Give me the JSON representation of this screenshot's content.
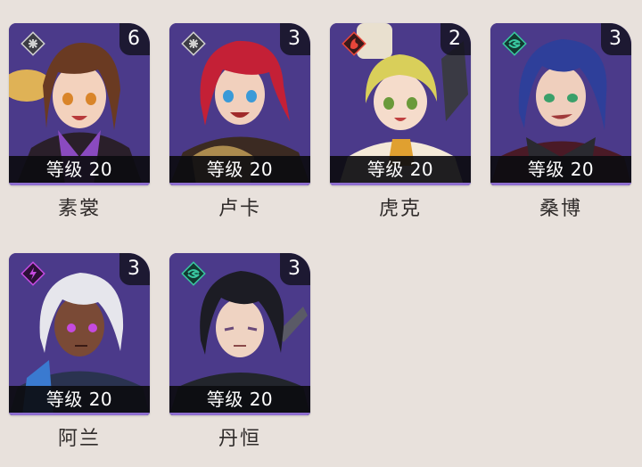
{
  "characters": [
    {
      "name": "素裳",
      "level_label": "等级 20",
      "eidolon": "6",
      "path_icon": "hunt-path-icon",
      "element_icon": "physical-element-icon",
      "element_color": "#c8c8c8",
      "hair": "#6a3a22",
      "skin": "#f3d2bd",
      "outfit": "#f0c050"
    },
    {
      "name": "卢卡",
      "level_label": "等级 20",
      "eidolon": "3",
      "path_icon": "nihility-path-icon",
      "element_icon": "physical-element-icon",
      "element_color": "#c8c8c8",
      "hair": "#c42036",
      "skin": "#f1d0bd",
      "outfit": "#3b2a22"
    },
    {
      "name": "虎克",
      "level_label": "等级 20",
      "eidolon": "2",
      "path_icon": "destruction-path-icon",
      "element_icon": "fire-element-icon",
      "element_color": "#e8463a",
      "hair": "#d9cf5a",
      "skin": "#f5dccb",
      "outfit": "#f4e9d8"
    },
    {
      "name": "桑博",
      "level_label": "等级 20",
      "eidolon": "3",
      "path_icon": "nihility-path-icon",
      "element_icon": "wind-element-icon",
      "element_color": "#39c7a0",
      "hair": "#2e3f9a",
      "skin": "#efcfbd",
      "outfit": "#4a1a26"
    },
    {
      "name": "阿兰",
      "level_label": "等级 20",
      "eidolon": "3",
      "path_icon": "destruction-path-icon",
      "element_icon": "lightning-element-icon",
      "element_color": "#c54ae0",
      "hair": "#e6e6ec",
      "skin": "#7a4a36",
      "outfit": "#2a3350"
    },
    {
      "name": "丹恒",
      "level_label": "等级 20",
      "eidolon": "3",
      "path_icon": "hunt-path-icon",
      "element_icon": "wind-element-icon",
      "element_color": "#39c7a0",
      "hair": "#1c1c24",
      "skin": "#efd3c2",
      "outfit": "#22252c"
    }
  ]
}
